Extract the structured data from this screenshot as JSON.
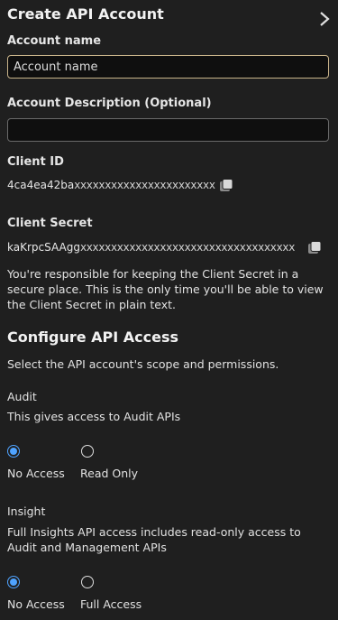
{
  "header": {
    "title": "Create API Account"
  },
  "account_name": {
    "label": "Account name",
    "value": "Account name"
  },
  "account_description": {
    "label": "Account Description (Optional)",
    "value": ""
  },
  "client_id": {
    "label": "Client ID",
    "prefix": "4ca4ea42ba",
    "masked": "xxxxxxxxxxxxxxxxxxxxxxx"
  },
  "client_secret": {
    "label": "Client Secret",
    "prefix": "kaKrpcSAAgg",
    "masked": "xxxxxxxxxxxxxxxxxxxxxxxxxxxxxxxxxxx",
    "note": "You're responsible for keeping the Client Secret in a secure place. This is the only time you'll be able to view the Client Secret in plain text."
  },
  "configure": {
    "title": "Configure API Access",
    "subtitle": "Select the API account's scope and permissions."
  },
  "audit": {
    "title": "Audit",
    "description": "This gives access to Audit APIs",
    "options": [
      {
        "label": "No Access",
        "checked": true
      },
      {
        "label": "Read Only",
        "checked": false
      }
    ]
  },
  "insight": {
    "title": "Insight",
    "description": "Full Insights API access includes read-only access to Audit and Management APIs",
    "options": [
      {
        "label": "No Access",
        "checked": true
      },
      {
        "label": "Full Access",
        "checked": false
      }
    ]
  },
  "icons": [
    "chevron-right-icon",
    "copy-icon"
  ],
  "colors": {
    "accent": "#4fa3ff",
    "focus_border": "#c8b38a",
    "background": "#1f1f1f"
  }
}
